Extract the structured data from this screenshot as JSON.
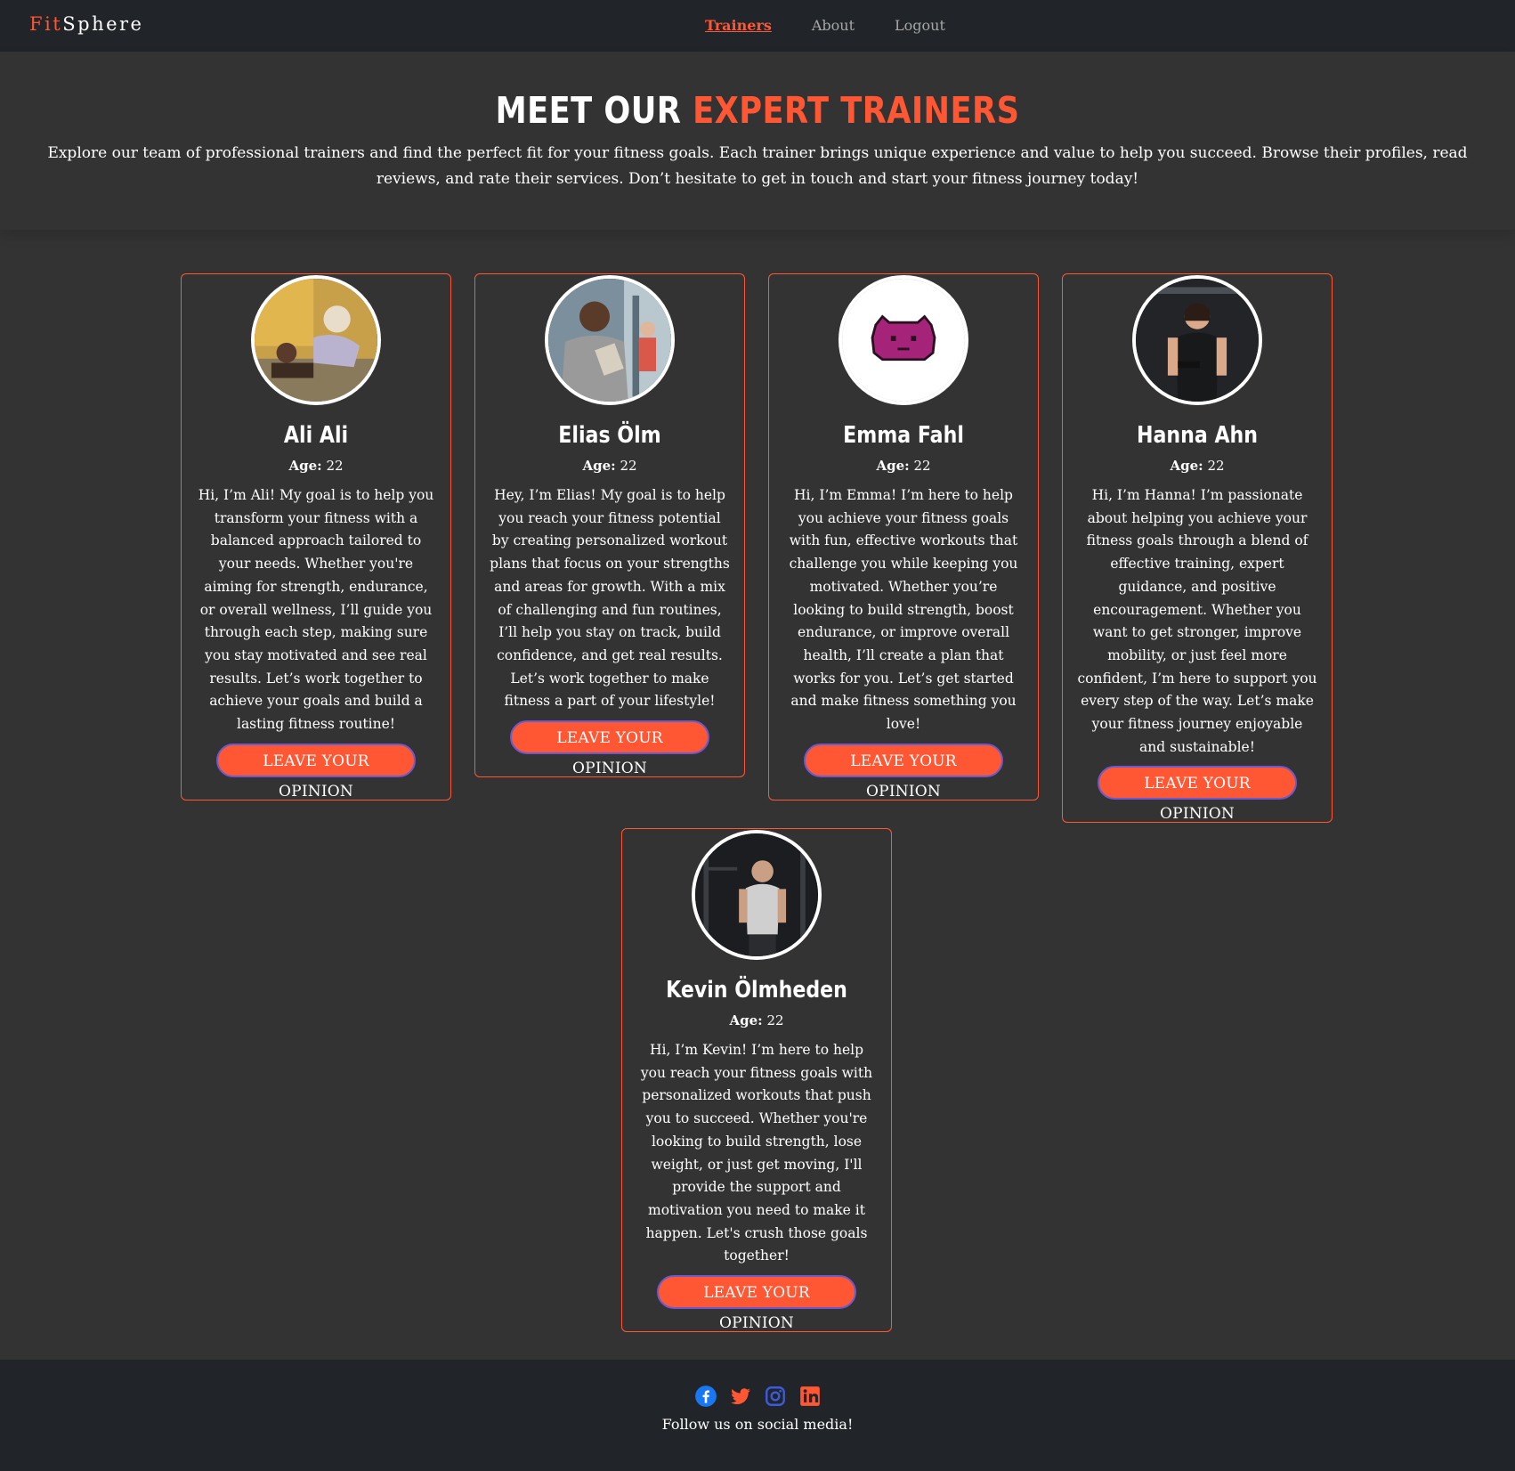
{
  "brand": {
    "part1": "Fit",
    "part2": "Sphere"
  },
  "nav": {
    "items": [
      "Trainers",
      "About",
      "Logout"
    ]
  },
  "hero": {
    "title_white": "MEET OUR",
    "title_accent": "EXPERT TRAINERS",
    "description": "Explore our team of professional trainers and find the perfect fit for your fitness goals. Each trainer brings unique experience and value to help you succeed. Browse their profiles, read reviews, and rate their services. Don’t hesitate to get in touch and start your fitness journey today!"
  },
  "age_label": "Age:",
  "trainers": [
    {
      "name": "Ali Ali",
      "age": "22",
      "bio": "Hi, I’m Ali! My goal is to help you transform your fitness with a balanced approach tailored to your needs. Whether you're aiming for strength, endurance, or overall wellness, I’ll guide you through each step, making sure you stay motivated and see real results. Let’s work together to achieve your goals and build a lasting fitness routine!",
      "button": "LEAVE YOUR OPINION"
    },
    {
      "name": "Elias Ölm",
      "age": "22",
      "bio": "Hey, I’m Elias! My goal is to help you reach your fitness potential by creating personalized workout plans that focus on your strengths and areas for growth. With a mix of challenging and fun routines, I’ll help you stay on track, build confidence, and get real results. Let’s work together to make fitness a part of your lifestyle!",
      "button": "LEAVE YOUR OPINION"
    },
    {
      "name": "Emma Fahl",
      "age": "22",
      "bio": "Hi, I’m Emma! I’m here to help you achieve your fitness goals with fun, effective workouts that challenge you while keeping you motivated. Whether you’re looking to build strength, boost endurance, or improve overall health, I’ll create a plan that works for you. Let’s get started and make fitness something you love!",
      "button": "LEAVE YOUR OPINION"
    },
    {
      "name": "Hanna Ahn",
      "age": "22",
      "bio": "Hi, I’m Hanna! I’m passionate about helping you achieve your fitness goals through a blend of effective training, expert guidance, and positive encouragement. Whether you want to get stronger, improve mobility, or just feel more confident, I’m here to support you every step of the way. Let’s make your fitness journey enjoyable and sustainable!",
      "button": "LEAVE YOUR OPINION"
    },
    {
      "name": "Kevin Ölmheden",
      "age": "22",
      "bio": "Hi, I’m Kevin! I’m here to help you reach your fitness goals with personalized workouts that push you to succeed. Whether you're looking to build strength, lose weight, or just get moving, I'll provide the support and motivation you need to make it happen. Let's crush those goals together!",
      "button": "LEAVE YOUR OPINION"
    }
  ],
  "footer": {
    "text": "Follow us on social media!",
    "socials": [
      "facebook-icon",
      "twitter-icon",
      "instagram-icon",
      "linkedin-icon"
    ]
  },
  "colors": {
    "accent": "#ff5733",
    "background": "#333333",
    "navbar": "#212529",
    "facebook": "#1877f2",
    "instagram": "#3b5bdb"
  }
}
